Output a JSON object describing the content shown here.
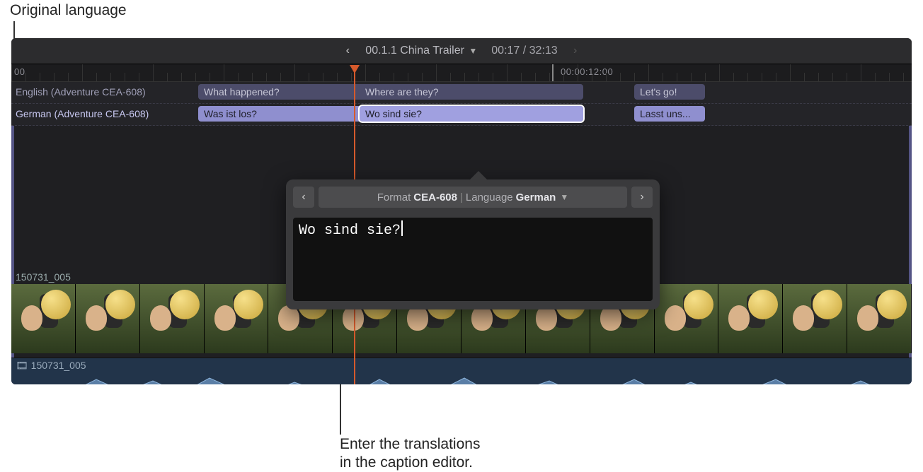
{
  "callouts": {
    "top": "Original language",
    "bottom_line1": "Enter the translations",
    "bottom_line2": "in the caption editor."
  },
  "topbar": {
    "title": "00.1.1 China Trailer",
    "timecode": "00:17 / 32:13"
  },
  "ruler": {
    "t0": "00",
    "t1": "00:00:12:00"
  },
  "lanes": {
    "english_label": "English (Adventure CEA-608)",
    "german_label": "German (Adventure CEA-608)"
  },
  "captions": {
    "en1": "What happened?",
    "en2": "Where are they?",
    "en3": "Let's go!",
    "de1": "Was ist los?",
    "de2": "Wo sind sie?",
    "de3": "Lasst uns..."
  },
  "popover": {
    "format_label": "Format",
    "format_value": "CEA-608",
    "lang_label": "Language",
    "lang_value": "German",
    "text": "Wo sind sie?"
  },
  "video_clip": "150731_005",
  "audio_clip": "150731_005"
}
